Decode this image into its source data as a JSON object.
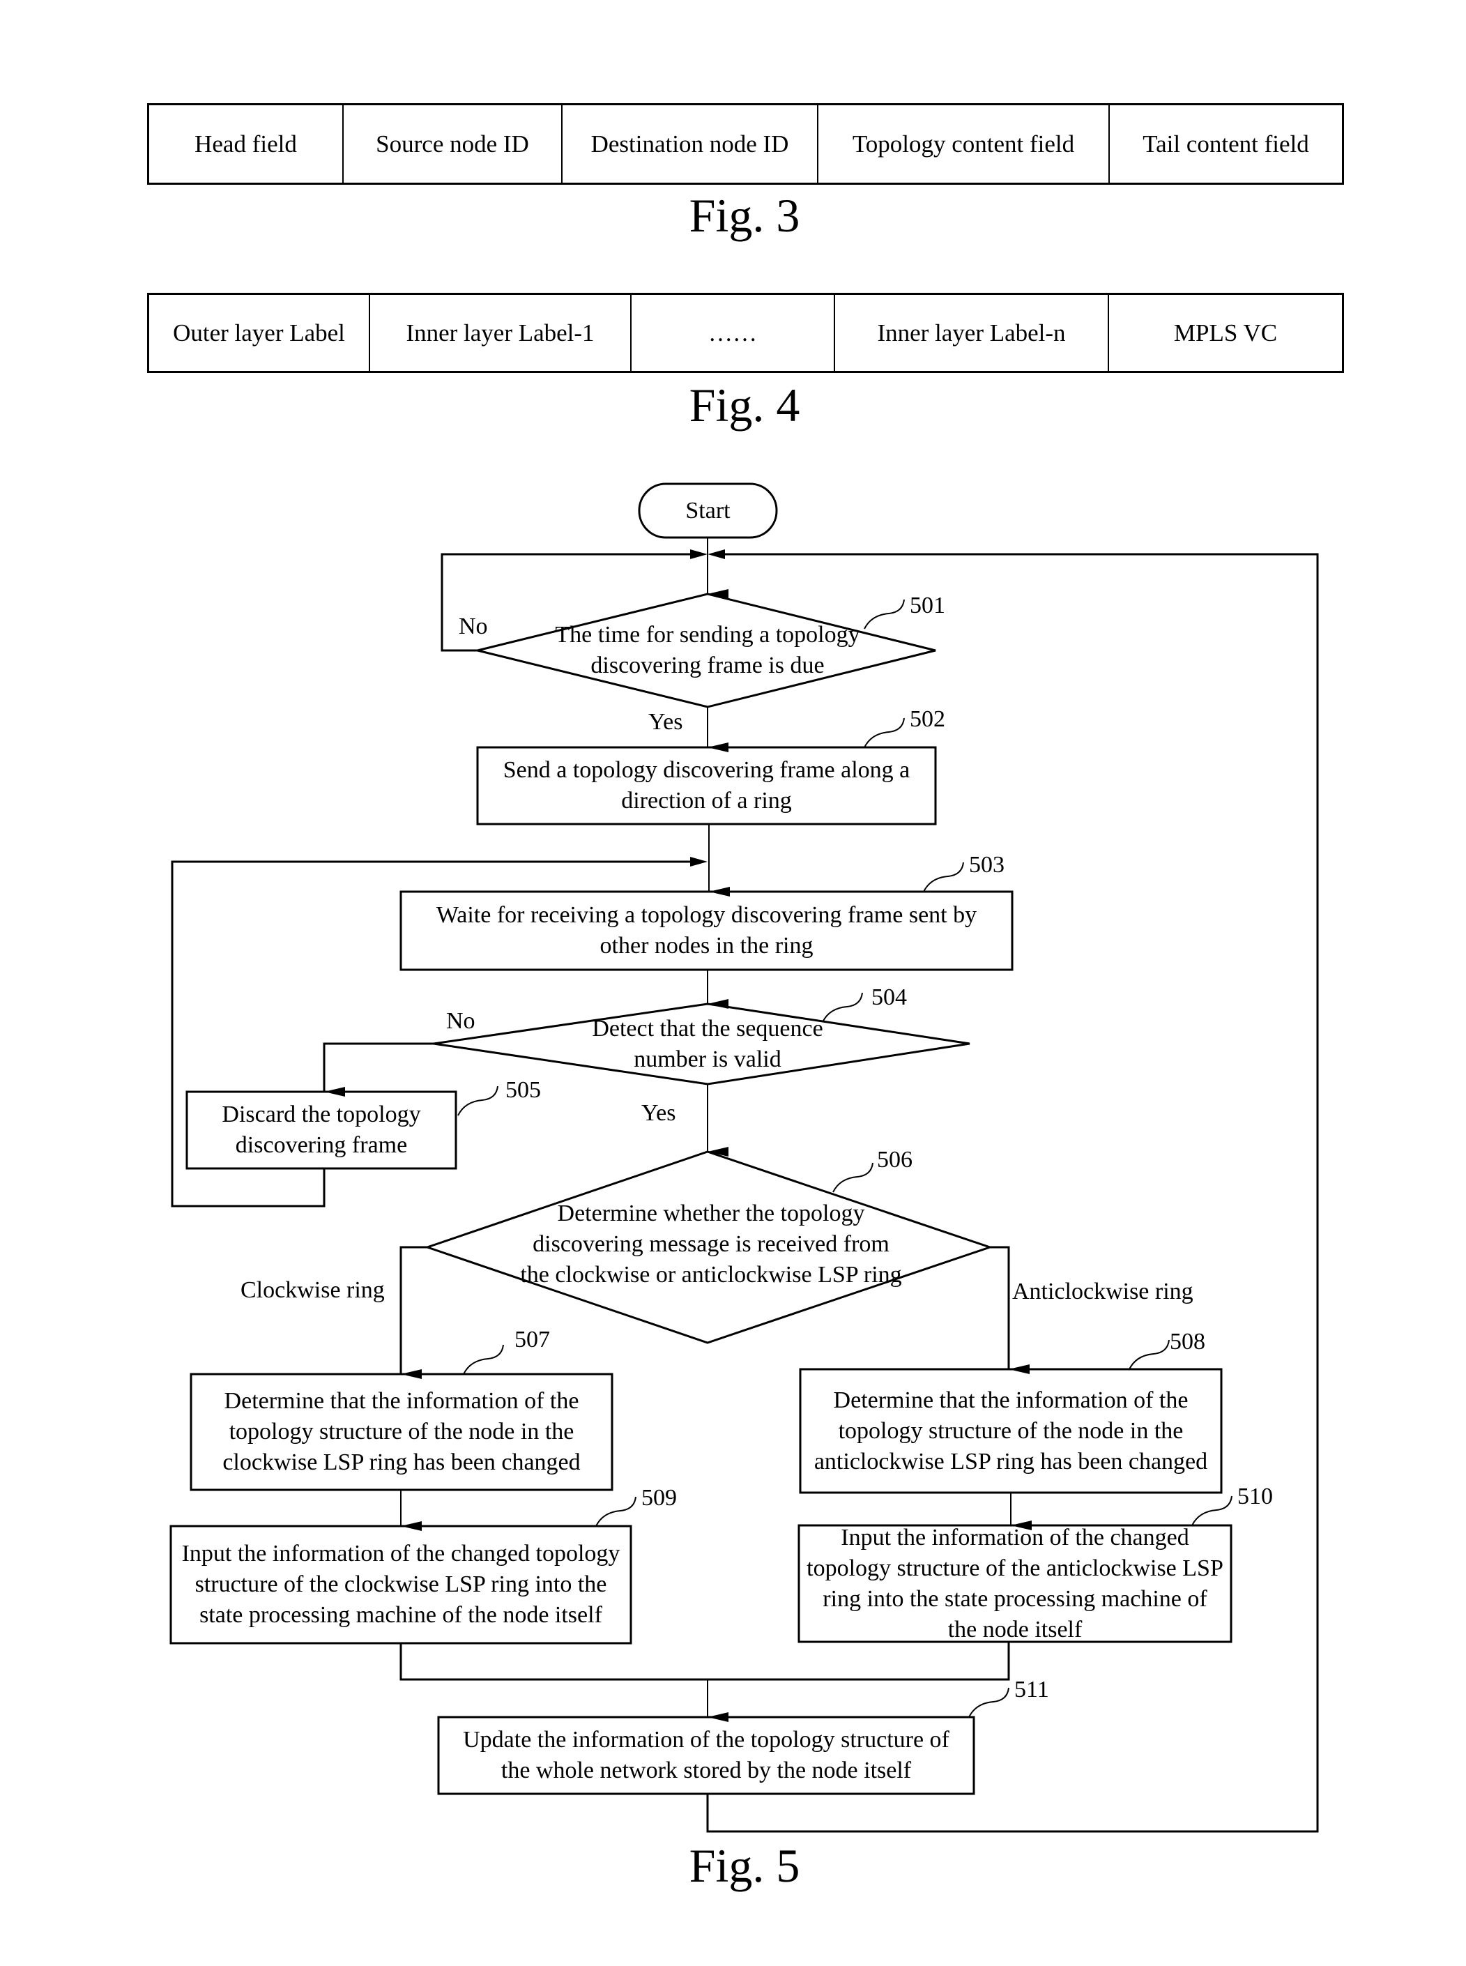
{
  "fig3": {
    "caption": "Fig. 3",
    "fields": [
      "Head field",
      "Source node ID",
      "Destination node ID",
      "Topology content field",
      "Tail content field"
    ]
  },
  "fig4": {
    "caption": "Fig. 4",
    "fields": [
      "Outer layer Label",
      "Inner layer Label-1",
      "……",
      "Inner layer Label-n",
      "MPLS VC"
    ]
  },
  "fig5": {
    "caption": "Fig. 5",
    "start": "Start",
    "steps": {
      "s501": {
        "ref": "501",
        "text": "The time for sending a topology discovering frame is due"
      },
      "s502": {
        "ref": "502",
        "text": "Send a topology discovering frame along a direction of a ring"
      },
      "s503": {
        "ref": "503",
        "text": "Waite for receiving a topology discovering frame sent by other nodes in the ring"
      },
      "s504": {
        "ref": "504",
        "text": "Detect that the sequence number is valid"
      },
      "s505": {
        "ref": "505",
        "text": "Discard the topology discovering frame"
      },
      "s506": {
        "ref": "506",
        "text": "Determine whether the topology discovering message is received from the clockwise or anticlockwise LSP ring"
      },
      "s507": {
        "ref": "507",
        "text": "Determine that the information of the topology structure of the node in the clockwise LSP ring has been changed"
      },
      "s508": {
        "ref": "508",
        "text": "Determine that the information of the topology structure of the node in the anticlockwise LSP ring has been changed"
      },
      "s509": {
        "ref": "509",
        "text": "Input the information of the changed topology structure of the clockwise LSP ring into the state processing machine of the node itself"
      },
      "s510": {
        "ref": "510",
        "text": "Input the information of the changed topology structure of the anticlockwise LSP ring into the state processing machine of the node itself"
      },
      "s511": {
        "ref": "511",
        "text": "Update the information of the topology structure of the whole network stored by the node itself"
      }
    },
    "labels": {
      "no_501": "No",
      "yes_501": "Yes",
      "no_504": "No",
      "yes_504": "Yes",
      "clockwise": "Clockwise ring",
      "anticlockwise": "Anticlockwise ring"
    }
  }
}
